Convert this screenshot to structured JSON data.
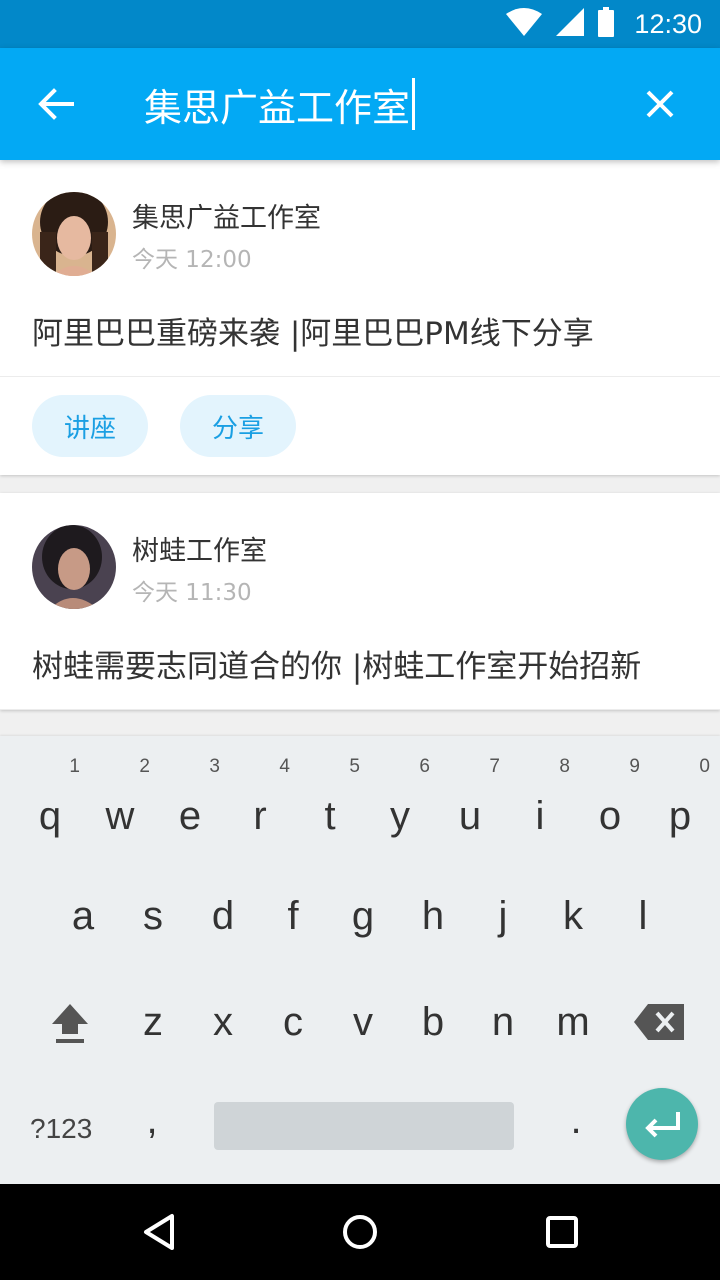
{
  "status_bar": {
    "time": "12:30"
  },
  "search": {
    "query": "集思广益工作室"
  },
  "posts": [
    {
      "author": "集思广益工作室",
      "time": "今天 12:00",
      "title": "阿里巴巴重磅来袭 |阿里巴巴PM线下分享",
      "tags": [
        "讲座",
        "分享"
      ]
    },
    {
      "author": "树蛙工作室",
      "time": "今天 11:30",
      "title": "树蛙需要志同道合的你 |树蛙工作室开始招新"
    }
  ],
  "keyboard": {
    "row1": [
      "q",
      "w",
      "e",
      "r",
      "t",
      "y",
      "u",
      "i",
      "o",
      "p"
    ],
    "row1_hints": [
      "1",
      "2",
      "3",
      "4",
      "5",
      "6",
      "7",
      "8",
      "9",
      "0"
    ],
    "row2": [
      "a",
      "s",
      "d",
      "f",
      "g",
      "h",
      "j",
      "k",
      "l"
    ],
    "row3": [
      "z",
      "x",
      "c",
      "v",
      "b",
      "n",
      "m"
    ],
    "symbols_label": "?123",
    "comma": ",",
    "period": "."
  },
  "colors": {
    "primary": "#03a9f4",
    "primary_dark": "#0288c9",
    "tag_bg": "#e3f4fd",
    "tag_text": "#1a9fe3",
    "enter": "#4db6ac"
  }
}
